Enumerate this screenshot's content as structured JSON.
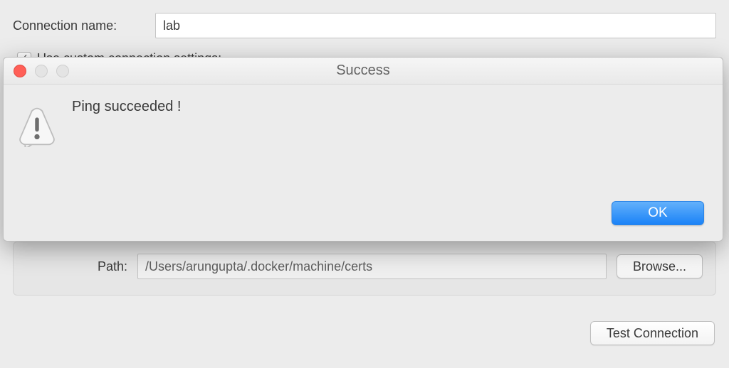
{
  "form": {
    "connection_name_label": "Connection name:",
    "connection_name_value": "lab",
    "custom_settings_label": "Use custom connection settings:",
    "path_label": "Path:",
    "path_value": "/Users/arungupta/.docker/machine/certs",
    "browse_label": "Browse...",
    "test_connection_label": "Test Connection"
  },
  "dialog": {
    "title": "Success",
    "message": "Ping succeeded !",
    "ok_label": "OK"
  }
}
